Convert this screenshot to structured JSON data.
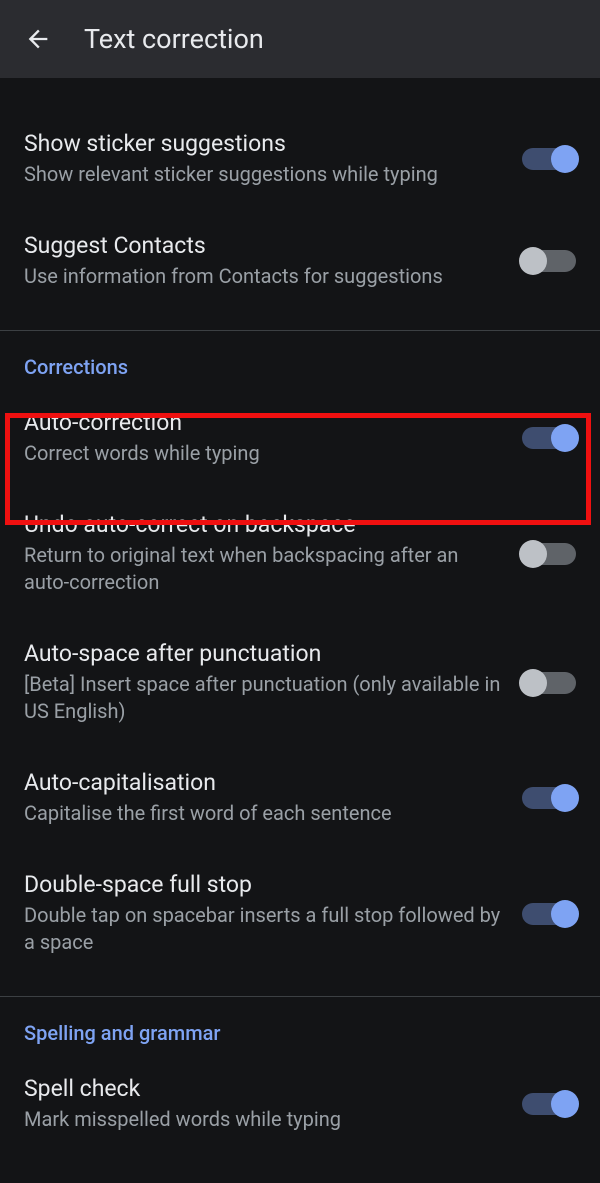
{
  "header": {
    "title": "Text correction"
  },
  "settings": {
    "stickerSuggestions": {
      "title": "Show sticker suggestions",
      "subtitle": "Show relevant sticker suggestions while typing",
      "enabled": true
    },
    "suggestContacts": {
      "title": "Suggest Contacts",
      "subtitle": "Use information from Contacts for suggestions",
      "enabled": false
    }
  },
  "sections": {
    "corrections": {
      "header": "Corrections",
      "items": {
        "autoCorrection": {
          "title": "Auto-correction",
          "subtitle": "Correct words while typing",
          "enabled": true
        },
        "undoAutoCorrect": {
          "title": "Undo auto-correct on backspace",
          "subtitle": "Return to original text when backspacing after an auto-correction",
          "enabled": false
        },
        "autoSpace": {
          "title": "Auto-space after punctuation",
          "subtitle": "[Beta] Insert space after punctuation (only available in US English)",
          "enabled": false
        },
        "autoCapitalisation": {
          "title": "Auto-capitalisation",
          "subtitle": "Capitalise the first word of each sentence",
          "enabled": true
        },
        "doubleSpace": {
          "title": "Double-space full stop",
          "subtitle": "Double tap on spacebar inserts a full stop followed by a space",
          "enabled": true
        }
      }
    },
    "spellingGrammar": {
      "header": "Spelling and grammar",
      "items": {
        "spellCheck": {
          "title": "Spell check",
          "subtitle": "Mark misspelled words while typing",
          "enabled": true
        }
      }
    }
  }
}
